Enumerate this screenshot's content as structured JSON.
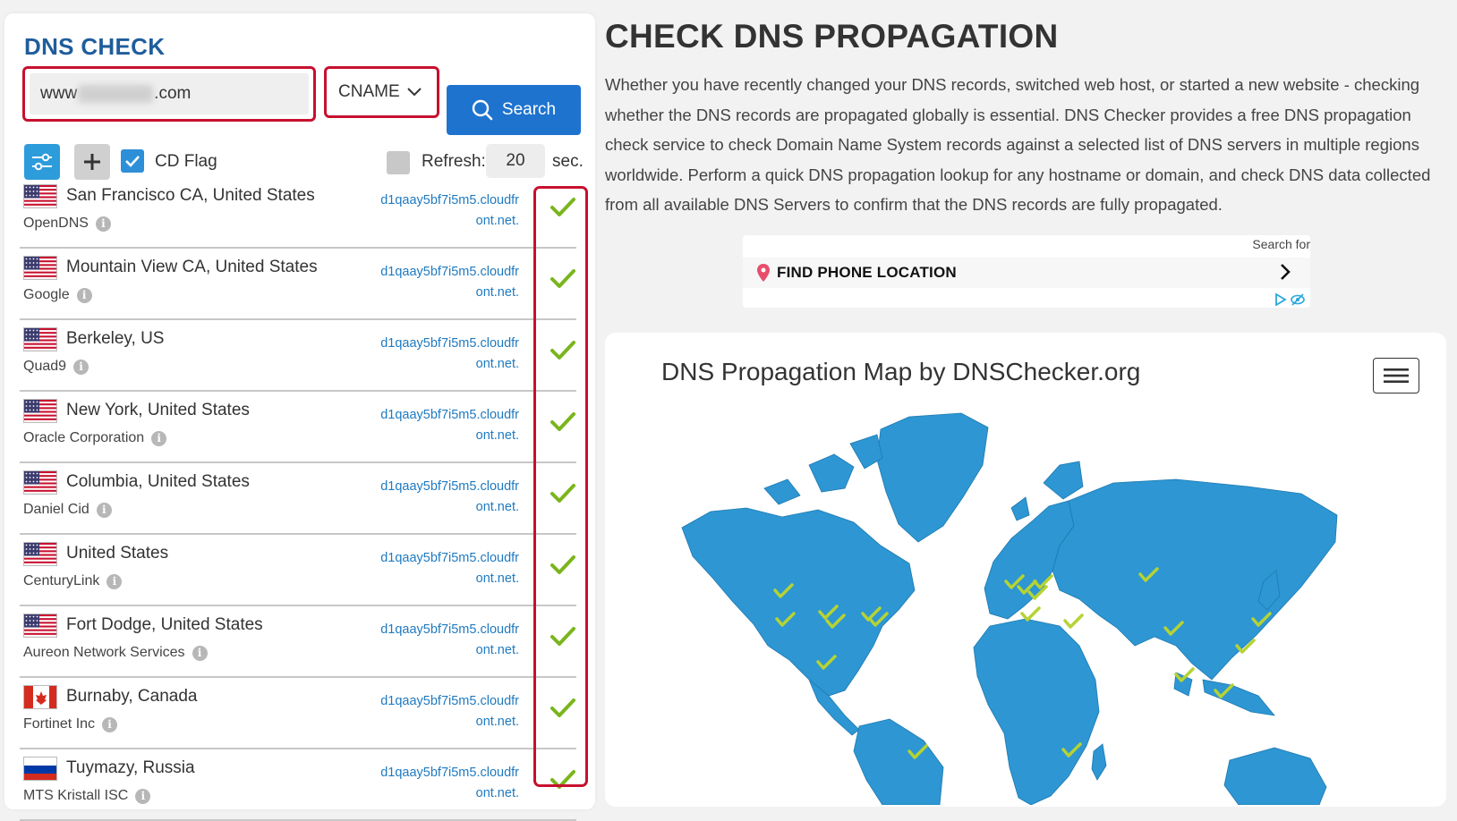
{
  "left_panel": {
    "title": "DNS CHECK",
    "domain_input": {
      "prefix": "www",
      "suffix": ".com"
    },
    "record_type": "CNAME",
    "search_label": "Search",
    "cd_flag_label": "CD Flag",
    "refresh_label": "Refresh:",
    "refresh_value": "20",
    "refresh_unit": "sec."
  },
  "results": [
    {
      "location": "San Francisco CA, United States",
      "provider": "OpenDNS",
      "flag": "us-flag",
      "value": "d1qaay5bf7i5m5.cloudfront.net.",
      "status": "check-icon"
    },
    {
      "location": "Mountain View CA, United States",
      "provider": "Google",
      "flag": "us-flag",
      "value": "d1qaay5bf7i5m5.cloudfront.net.",
      "status": "check-icon"
    },
    {
      "location": "Berkeley, US",
      "provider": "Quad9",
      "flag": "us-flag",
      "value": "d1qaay5bf7i5m5.cloudfront.net.",
      "status": "check-icon"
    },
    {
      "location": "New York, United States",
      "provider": "Oracle Corporation",
      "flag": "us-flag",
      "value": "d1qaay5bf7i5m5.cloudfront.net.",
      "status": "check-icon"
    },
    {
      "location": "Columbia, United States",
      "provider": "Daniel Cid",
      "flag": "us-flag",
      "value": "d1qaay5bf7i5m5.cloudfront.net.",
      "status": "check-icon"
    },
    {
      "location": "United States",
      "provider": "CenturyLink",
      "flag": "us-flag",
      "value": "d1qaay5bf7i5m5.cloudfront.net.",
      "status": "check-icon"
    },
    {
      "location": "Fort Dodge, United States",
      "provider": "Aureon Network Services",
      "flag": "us-flag",
      "value": "d1qaay5bf7i5m5.cloudfront.net.",
      "status": "check-icon"
    },
    {
      "location": "Burnaby, Canada",
      "provider": "Fortinet Inc",
      "flag": "ca-flag",
      "value": "d1qaay5bf7i5m5.cloudfront.net.",
      "status": "check-icon"
    },
    {
      "location": "Tuymazy, Russia",
      "provider": "MTS Kristall ISC",
      "flag": "ru-flag",
      "value": "d1qaay5bf7i5m5.cloudfront.net.",
      "status": "check-icon"
    }
  ],
  "main": {
    "heading": "CHECK DNS PROPAGATION",
    "description": "Whether you have recently changed your DNS records, switched web host, or started a new website - checking whether the DNS records are propagated globally is essential. DNS Checker provides a free DNS propagation check service to check Domain Name System records against a selected list of DNS servers in multiple regions worldwide. Perform a quick DNS propagation lookup for any hostname or domain, and check DNS data collected from all available DNS Servers to confirm that the DNS records are fully propagated."
  },
  "ad": {
    "search_for": "Search for",
    "link_text": "FIND PHONE LOCATION"
  },
  "map": {
    "title": "DNS Propagation Map by DNSChecker.org"
  },
  "colors": {
    "brand_blue": "#1f5d9c",
    "button_blue": "#1e73cf",
    "highlight_red": "#c8102e",
    "check_green": "#7ab51d",
    "map_blue": "#2d96d3"
  }
}
